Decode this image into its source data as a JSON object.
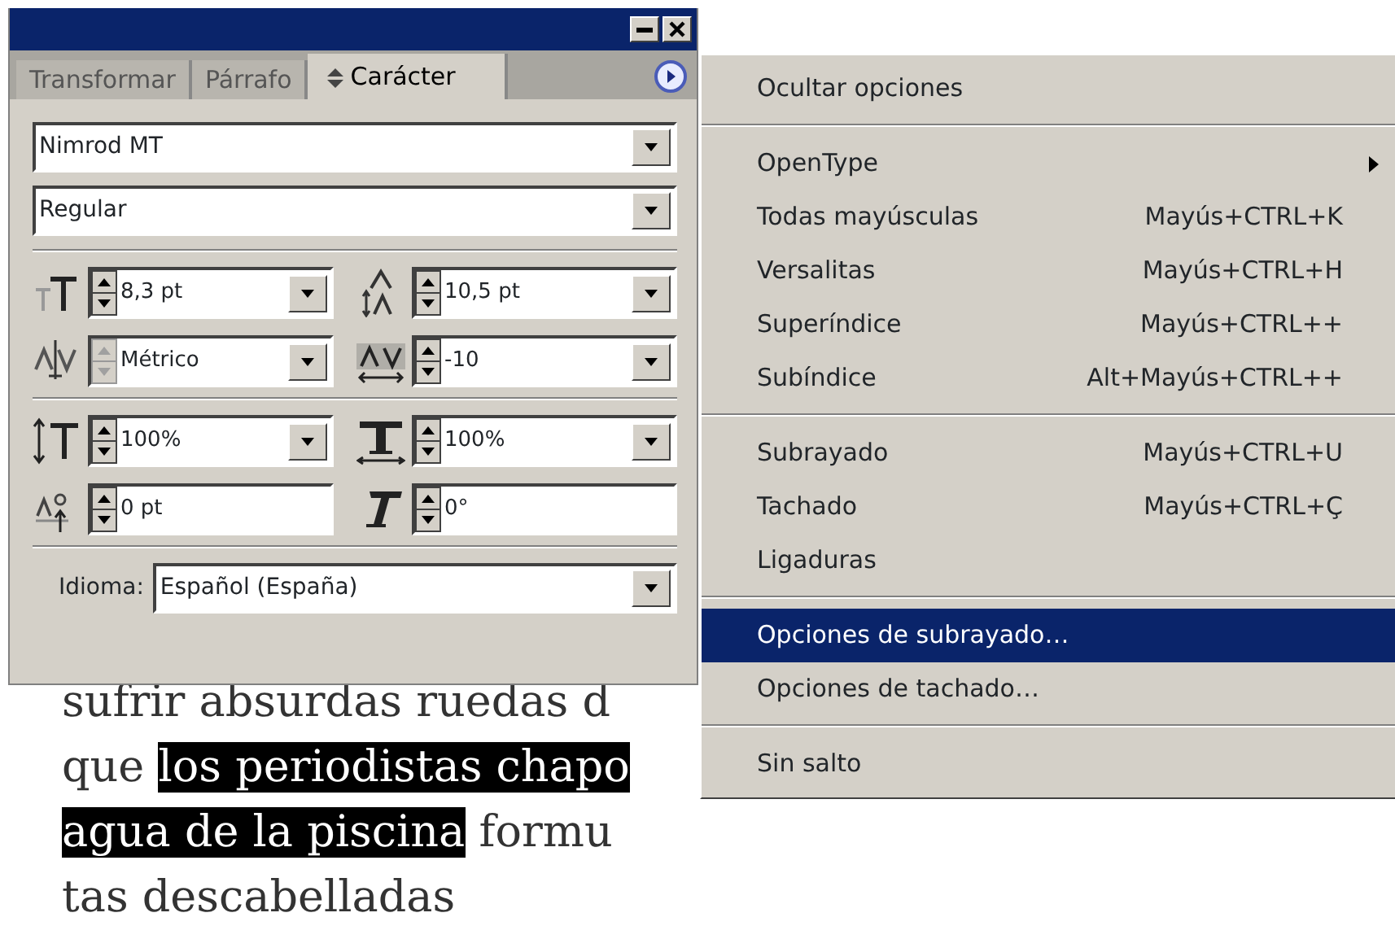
{
  "panel": {
    "tabs": [
      {
        "label": "Transformar",
        "selected": false
      },
      {
        "label": "Párrafo",
        "selected": false
      },
      {
        "label": "Carácter",
        "selected": true
      }
    ],
    "font_family": "Nimrod MT",
    "font_style": "Regular",
    "fields": [
      {
        "kind": "font-size",
        "value": "8,3 pt",
        "dropdown": true,
        "disabled": false
      },
      {
        "kind": "leading",
        "value": "10,5 pt",
        "dropdown": true,
        "disabled": false
      },
      {
        "kind": "kerning",
        "value": "Métrico",
        "dropdown": true,
        "disabled": true
      },
      {
        "kind": "tracking",
        "value": "-10",
        "dropdown": true,
        "disabled": false
      },
      {
        "kind": "vertical-scale",
        "value": "100%",
        "dropdown": true,
        "disabled": false
      },
      {
        "kind": "horizontal-scale",
        "value": "100%",
        "dropdown": true,
        "disabled": false
      },
      {
        "kind": "baseline-shift",
        "value": "0 pt",
        "dropdown": false,
        "disabled": false
      },
      {
        "kind": "skew",
        "value": "0°",
        "dropdown": false,
        "disabled": false
      }
    ],
    "language_label": "Idioma:",
    "language": "Español (España)"
  },
  "menu": [
    {
      "kind": "item",
      "label": "Ocultar opciones",
      "selected": false
    },
    {
      "kind": "separator"
    },
    {
      "kind": "item",
      "label": "OpenType",
      "submenu": true,
      "selected": false
    },
    {
      "kind": "item",
      "label": "Todas mayúsculas",
      "shortcut": "Mayús+CTRL+K",
      "selected": false
    },
    {
      "kind": "item",
      "label": "Versalitas",
      "shortcut": "Mayús+CTRL+H",
      "selected": false
    },
    {
      "kind": "item",
      "label": "Superíndice",
      "shortcut": "Mayús+CTRL++",
      "selected": false
    },
    {
      "kind": "item",
      "label": "Subíndice",
      "shortcut": "Alt+Mayús+CTRL++",
      "selected": false
    },
    {
      "kind": "separator"
    },
    {
      "kind": "item",
      "label": "Subrayado",
      "shortcut": "Mayús+CTRL+U",
      "selected": false
    },
    {
      "kind": "item",
      "label": "Tachado",
      "shortcut": "Mayús+CTRL+Ç",
      "selected": false
    },
    {
      "kind": "item",
      "label": "Ligaduras",
      "selected": false
    },
    {
      "kind": "separator"
    },
    {
      "kind": "item",
      "label": "Opciones de subrayado…",
      "selected": true
    },
    {
      "kind": "item",
      "label": "Opciones de tachado…",
      "selected": false
    },
    {
      "kind": "separator"
    },
    {
      "kind": "item",
      "label": "Sin salto",
      "selected": false
    }
  ],
  "document": {
    "lines": [
      [
        {
          "text": "sufrir absurdas ruedas d",
          "highlighted": false
        }
      ],
      [
        {
          "text": "que ",
          "highlighted": false
        },
        {
          "text": "los periodistas chapo",
          "highlighted": true
        }
      ],
      [
        {
          "text": "agua de la piscina",
          "highlighted": true
        },
        {
          "text": " formu",
          "highlighted": false
        }
      ],
      [
        {
          "text": "tas descabelladas",
          "highlighted": false
        }
      ]
    ]
  }
}
